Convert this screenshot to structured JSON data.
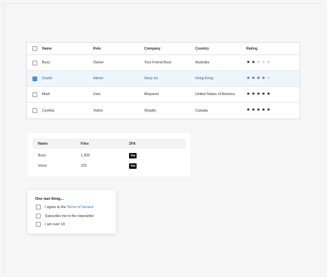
{
  "table1": {
    "columns": [
      "Name",
      "Role",
      "Company",
      "Country",
      "Rating"
    ],
    "rows": [
      {
        "name": "Buzz",
        "role": "Owner",
        "company": "Your Friend Buzz",
        "country": "Australia",
        "rating": 2,
        "selected": false
      },
      {
        "name": "Dustin",
        "role": "Admin",
        "company": "Story Inc",
        "country": "Hong Kong",
        "rating": 4,
        "selected": true
      },
      {
        "name": "Mark",
        "role": "User",
        "company": "Mixpanel",
        "country": "United States of America",
        "rating": 5,
        "selected": false
      },
      {
        "name": "Cynthia",
        "role": "Visitor",
        "company": "Shopify",
        "country": "Canada",
        "rating": 5,
        "selected": false
      }
    ],
    "max_rating": 5,
    "star_icon": "star-icon"
  },
  "table2": {
    "columns": [
      "Name",
      "Files",
      "2FA"
    ],
    "rows": [
      {
        "name": "Buzz",
        "files": "1,309",
        "twofa": "Yes"
      },
      {
        "name": "Victor",
        "files": "220",
        "twofa": "Yes"
      }
    ]
  },
  "form": {
    "title": "One last thing...",
    "options": [
      {
        "prefix": "I agree to the ",
        "link": "Terms of Service",
        "checked": false
      },
      {
        "prefix": "Subscribe me to the newsletter",
        "link": "",
        "checked": false
      },
      {
        "prefix": "I am over 18",
        "link": "",
        "checked": false
      }
    ]
  },
  "colors": {
    "accent": "#4a90d9",
    "selected_row_bg": "#eef6fd",
    "selected_text": "#1f5f99",
    "link": "#2f6fc0"
  }
}
